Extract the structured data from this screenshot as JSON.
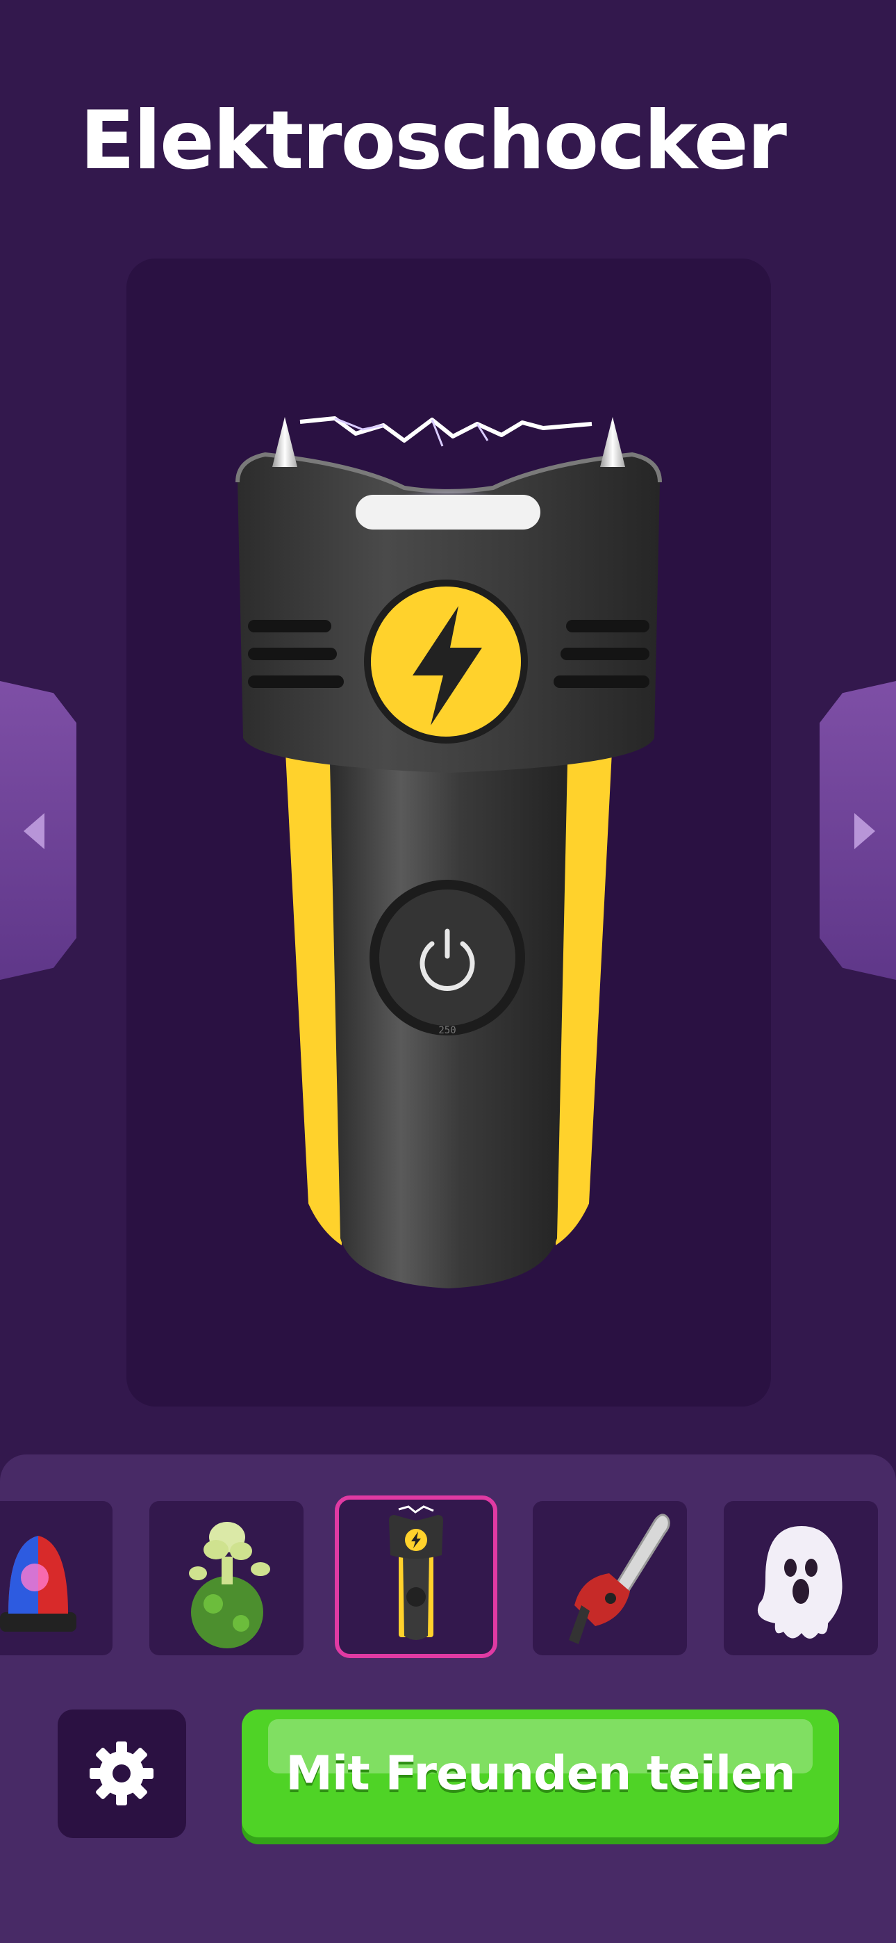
{
  "header": {
    "title": "Elektroschocker"
  },
  "carousel": {
    "prev_icon": "triangle-left-icon",
    "next_icon": "triangle-right-icon"
  },
  "device": {
    "name": "stun-gun",
    "power_icon": "power-icon",
    "lightning_icon": "lightning-bolt-icon",
    "voltage_marking": "250"
  },
  "tray": {
    "items": [
      {
        "name": "police-siren",
        "icon": "siren-icon",
        "selected": false
      },
      {
        "name": "fart-cloud",
        "icon": "stink-cloud-icon",
        "selected": false
      },
      {
        "name": "stun-gun",
        "icon": "stun-gun-icon",
        "selected": true
      },
      {
        "name": "chainsaw",
        "icon": "chainsaw-icon",
        "selected": false
      },
      {
        "name": "ghost",
        "icon": "ghost-icon",
        "selected": false
      }
    ]
  },
  "footer": {
    "settings_icon": "gear-icon",
    "share_label": "Mit Freunden teilen"
  },
  "colors": {
    "background": "#33184d",
    "stage": "#2a1142",
    "tray": "#482a66",
    "accent_yellow": "#ffd22c",
    "selection_pink": "#e03aa3",
    "share_green": "#4fd326"
  }
}
